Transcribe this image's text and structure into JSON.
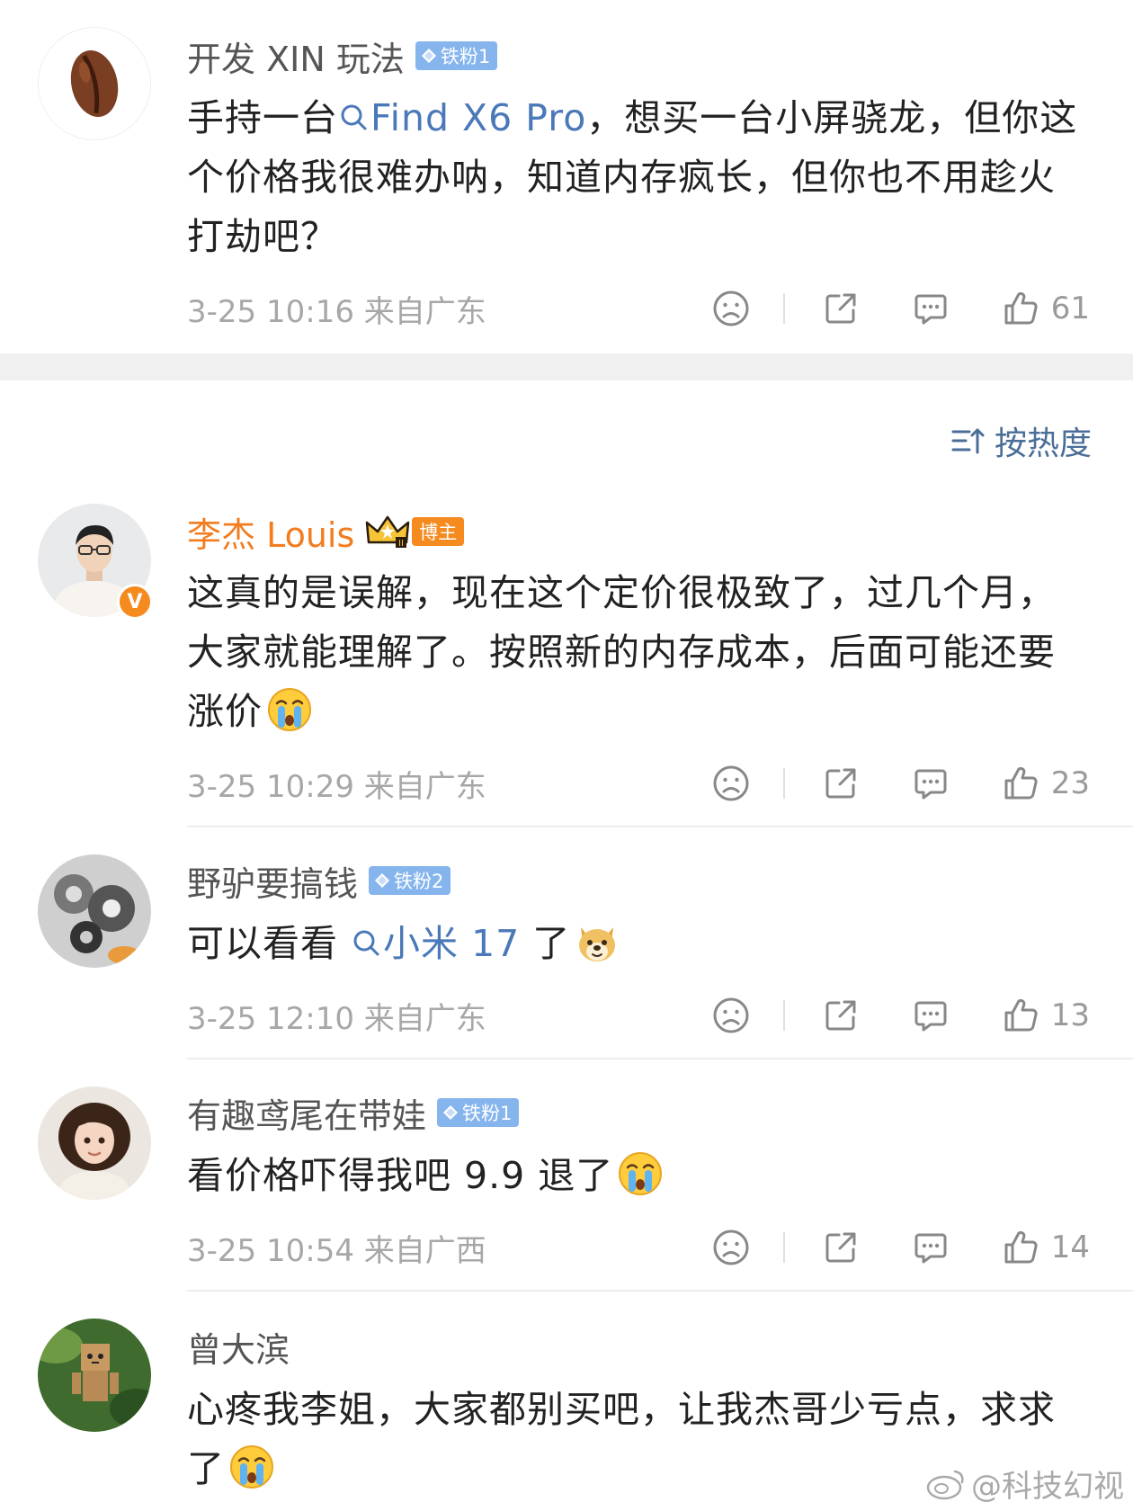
{
  "sort": {
    "label": "按热度"
  },
  "posts": [
    {
      "name": "开发 XIN 玩法",
      "badge": "铁粉1",
      "content_pre": "手持一台",
      "topic": "Find X6 Pro",
      "content_post": "，想买一台小屏骁龙，但你这个价格我很难办呐，知道内存疯长，但你也不用趁火打劫吧？",
      "meta": "3-25 10:16  来自广东",
      "likes": "61"
    },
    {
      "name": "李杰 Louis",
      "badge": "博主",
      "verified": "V",
      "content": "这真的是误解，现在这个定价很极致了，过几个月，大家就能理解了。按照新的内存成本，后面可能还要涨价",
      "meta": "3-25 10:29  来自广东",
      "likes": "23"
    },
    {
      "name": "野驴要搞钱",
      "badge": "铁粉2",
      "content_pre": "可以看看",
      "topic": "小米 17",
      "content_post": " 了",
      "meta": "3-25 12:10  来自广东",
      "likes": "13"
    },
    {
      "name": "有趣鸢尾在带娃",
      "badge": "铁粉1",
      "content": "看价格吓得我吧 9.9 退了",
      "meta": "3-25 10:54  来自广西",
      "likes": "14"
    },
    {
      "name": "曾大滨",
      "content": "心疼我李姐，大家都别买吧，让我杰哥少亏点，求求了"
    }
  ],
  "watermark": "@科技幻视"
}
